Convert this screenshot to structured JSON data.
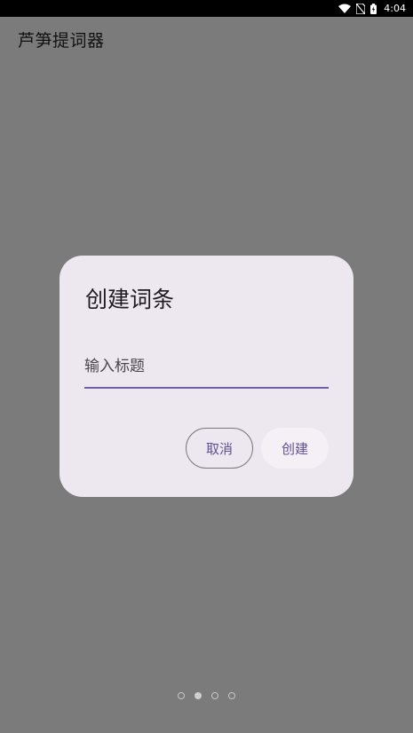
{
  "status_bar": {
    "time": "4:04",
    "icons": [
      "wifi-icon",
      "no-sim-icon",
      "battery-icon"
    ]
  },
  "app": {
    "title": "芦笋提词器"
  },
  "dialog": {
    "title": "创建词条",
    "input": {
      "placeholder": "输入标题",
      "value": ""
    },
    "cancel_label": "取消",
    "create_label": "创建"
  },
  "pager": {
    "count": 4,
    "active_index": 1
  },
  "colors": {
    "scrim": "#7b7b7b",
    "dialog_bg": "#ede8ef",
    "accent": "#6f5fa8",
    "button_text": "#5f4f94"
  }
}
